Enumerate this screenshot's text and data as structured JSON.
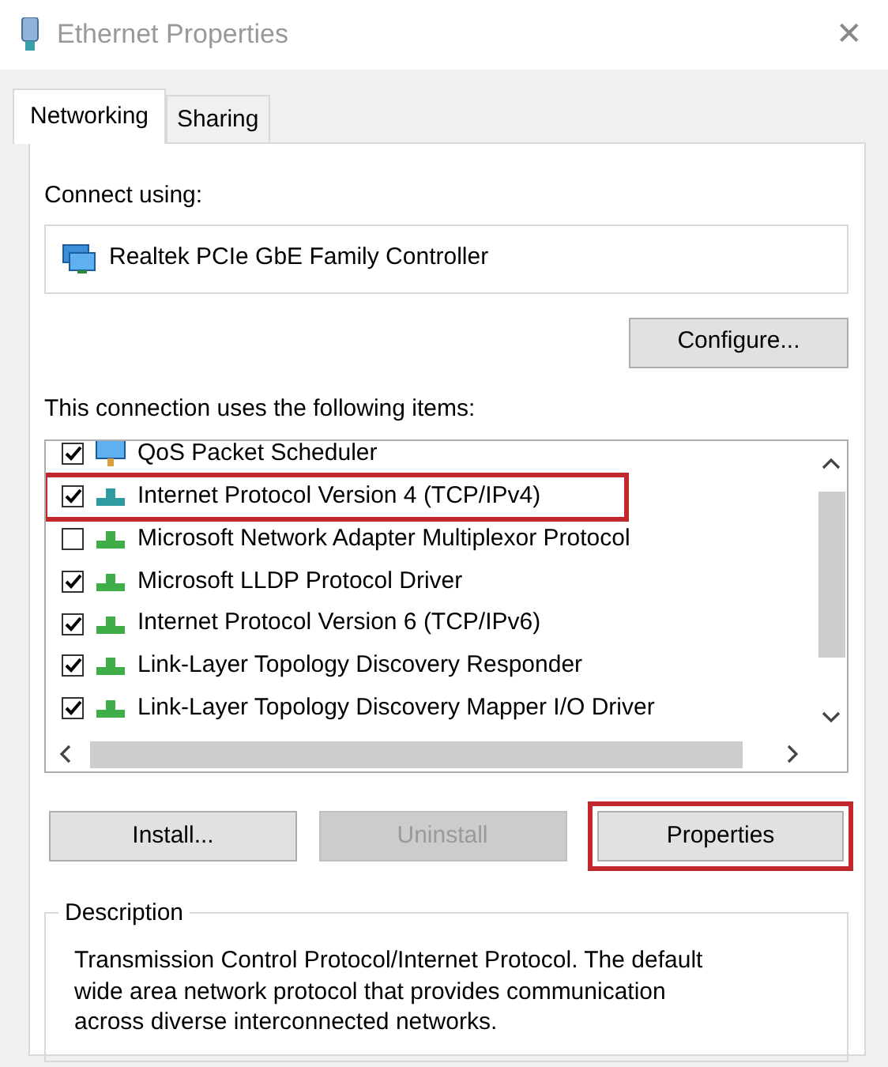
{
  "window": {
    "title": "Ethernet Properties",
    "close": "✕"
  },
  "tabs": [
    {
      "label": "Networking",
      "selected": true
    },
    {
      "label": "Sharing",
      "selected": false
    }
  ],
  "connect_using": {
    "label": "Connect using:",
    "adapter": "Realtek PCIe GbE Family Controller"
  },
  "configure_button": "Configure...",
  "items_label": "This connection uses the following items:",
  "items": [
    {
      "label": "QoS Packet Scheduler",
      "checked": true,
      "kind": "service",
      "highlighted": false
    },
    {
      "label": "Internet Protocol Version 4 (TCP/IPv4)",
      "checked": true,
      "kind": "protocol",
      "highlighted": true
    },
    {
      "label": "Microsoft Network Adapter Multiplexor Protocol",
      "checked": false,
      "kind": "protocol",
      "highlighted": false
    },
    {
      "label": "Microsoft LLDP Protocol Driver",
      "checked": true,
      "kind": "protocol",
      "highlighted": false
    },
    {
      "label": "Internet Protocol Version 6 (TCP/IPv6)",
      "checked": true,
      "kind": "protocol",
      "highlighted": false
    },
    {
      "label": "Link-Layer Topology Discovery Responder",
      "checked": true,
      "kind": "protocol",
      "highlighted": false
    },
    {
      "label": "Link-Layer Topology Discovery Mapper I/O Driver",
      "checked": true,
      "kind": "protocol",
      "highlighted": false
    }
  ],
  "buttons": [
    {
      "label": "Install...",
      "disabled": false,
      "highlighted": false
    },
    {
      "label": "Uninstall",
      "disabled": true,
      "highlighted": false
    },
    {
      "label": "Properties",
      "disabled": false,
      "highlighted": true
    }
  ],
  "description": {
    "title": "Description",
    "text": "Transmission Control Protocol/Internet Protocol. The default wide area network protocol that provides communication across diverse interconnected networks."
  }
}
